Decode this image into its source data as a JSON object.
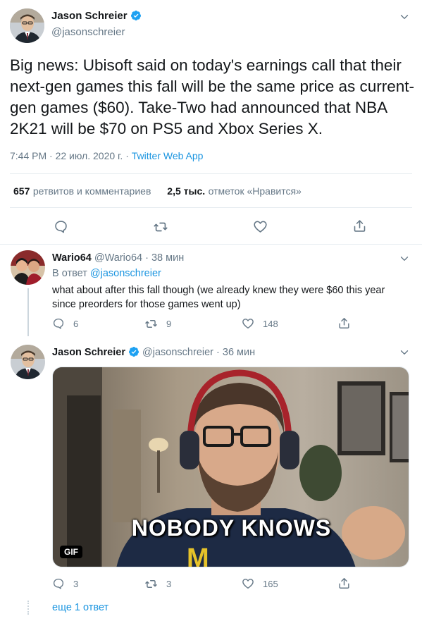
{
  "main_tweet": {
    "author_name": "Jason Schreier",
    "author_handle": "@jasonschreier",
    "text": "Big news: Ubisoft said on today's earnings call that their next-gen games this fall will be the same price as current-gen games ($60). Take-Two had announced that NBA 2K21 will be $70 on PS5 and Xbox Series X.",
    "timestamp": "7:44 PM · 22 июл. 2020 г. · ",
    "source": "Twitter Web App",
    "retweets_count": "657",
    "retweets_label": "ретвитов и комментариев",
    "likes_count": "2,5 тыс.",
    "likes_label": "отметок «Нравится»"
  },
  "reply1": {
    "author_name": "Wario64",
    "author_handle": "@Wario64",
    "time": " · 38 мин",
    "reply_prefix": "В ответ ",
    "reply_to": "@jasonschreier",
    "text": "what about after this fall though (we already knew they were $60 this year since preorders for those games went up)",
    "replies": "6",
    "retweets": "9",
    "likes": "148"
  },
  "reply2": {
    "author_name": "Jason Schreier",
    "author_handle": "@jasonschreier",
    "time": " · 36 мин",
    "gif_caption": "NOBODY KNOWS",
    "gif_badge": "GIF",
    "replies": "3",
    "retweets": "3",
    "likes": "165"
  },
  "more_replies": "еще 1 ответ",
  "colors": {
    "accent": "#1b95e0",
    "verified": "#1da1f2",
    "text": "#14171a",
    "secondary": "#657786",
    "divider": "#e6ecf0"
  }
}
